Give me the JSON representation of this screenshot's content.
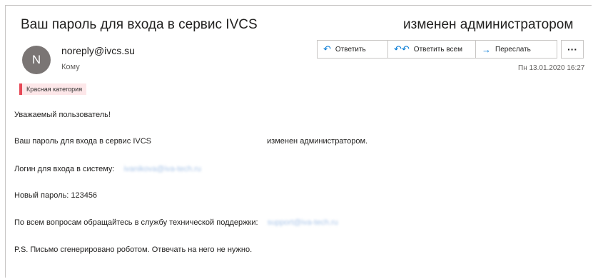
{
  "header": {
    "subject_left": "Ваш пароль для входа в сервис IVCS",
    "subject_right": "изменен администратором"
  },
  "sender": {
    "avatar_initial": "N",
    "email": "noreply@ivcs.su",
    "to_label": "Кому",
    "category": "Красная категория",
    "category_color": "#e74856"
  },
  "actions": {
    "reply": "Ответить",
    "reply_all": "Ответить всем",
    "forward": "Переслать",
    "more": "···"
  },
  "date": "Пн 13.01.2020 16:27",
  "body": {
    "greeting": "Уважаемый пользователь!",
    "line1_left": "Ваш пароль для входа в сервис IVCS",
    "line1_right": "изменен администратором.",
    "login_label": "Логин для входа в систему:",
    "login_value": "ivanikova@iva-tech.ru",
    "password_line": "Новый пароль: 123456",
    "support_label": "По всем вопросам обращайтесь в службу технической поддержки:",
    "support_value": "support@iva-tech.ru",
    "ps": "P.S. Письмо сгенерировано роботом. Отвечать на него не нужно."
  },
  "colors": {
    "accent": "#0078d4",
    "avatar_bg": "#7a7574",
    "link": "#a8c4e8"
  }
}
